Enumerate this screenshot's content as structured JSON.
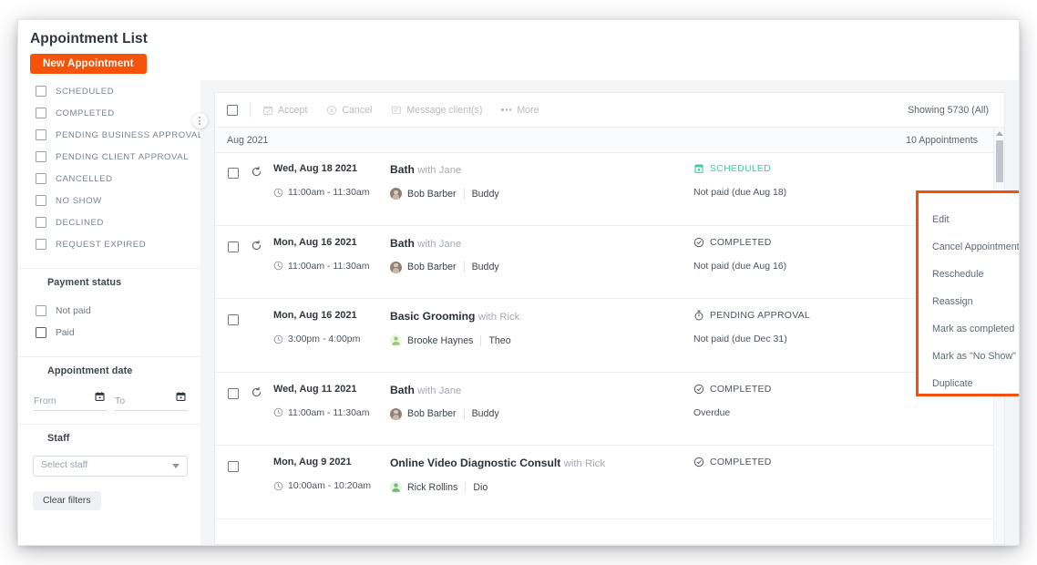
{
  "header": {
    "title": "Appointment List",
    "new_button": "New Appointment"
  },
  "sidebar": {
    "status_filters": [
      {
        "label": "SCHEDULED",
        "checked": false
      },
      {
        "label": "COMPLETED",
        "checked": false
      },
      {
        "label": "PENDING BUSINESS APPROVAL",
        "checked": false
      },
      {
        "label": "PENDING CLIENT APPROVAL",
        "checked": false
      },
      {
        "label": "CANCELLED",
        "checked": false
      },
      {
        "label": "NO SHOW",
        "checked": false
      },
      {
        "label": "DECLINED",
        "checked": false
      },
      {
        "label": "REQUEST EXPIRED",
        "checked": false
      }
    ],
    "payment": {
      "heading": "Payment status",
      "options": [
        {
          "label": "Not paid",
          "checked": false
        },
        {
          "label": "Paid",
          "checked": false
        }
      ]
    },
    "appointment_date": {
      "heading": "Appointment date",
      "from_placeholder": "From",
      "to_placeholder": "To",
      "from_value": "",
      "to_value": ""
    },
    "staff": {
      "heading": "Staff",
      "select_placeholder": "Select staff",
      "select_value": ""
    },
    "clear_filters": "Clear filters",
    "collapse_handle_icon": "drag-dots-icon"
  },
  "toolbar": {
    "select_all_checked": false,
    "actions": [
      {
        "label": "Accept",
        "icon": "calendar-check-icon",
        "enabled": false
      },
      {
        "label": "Cancel",
        "icon": "cancel-circle-icon",
        "enabled": false
      },
      {
        "label": "Message client(s)",
        "icon": "message-icon",
        "enabled": false
      },
      {
        "label": "More",
        "icon": "ellipsis-icon",
        "enabled": false
      }
    ],
    "showing": "Showing 5730 (All)"
  },
  "month_band": {
    "month": "Aug 2021",
    "count": "10 Appointments"
  },
  "appointments": [
    {
      "checked": false,
      "recurring": true,
      "date": "Wed, Aug 18 2021",
      "time": "11:00am - 11:30am",
      "service": "Bath",
      "with": "with Jane",
      "client": "Bob Barber",
      "avatar_kind": "photo",
      "pet": "Buddy",
      "status": "SCHEDULED",
      "status_icon": "calendar-icon",
      "status_color": "#3ecf9b",
      "payment": "Not paid (due Aug 18)"
    },
    {
      "checked": false,
      "recurring": true,
      "date": "Mon, Aug 16 2021",
      "time": "11:00am - 11:30am",
      "service": "Bath",
      "with": "with Jane",
      "client": "Bob Barber",
      "avatar_kind": "photo",
      "pet": "Buddy",
      "status": "COMPLETED",
      "status_icon": "check-circle-icon",
      "status_color": "#4d5561",
      "payment": "Not paid (due Aug 16)"
    },
    {
      "checked": false,
      "recurring": false,
      "date": "Mon, Aug 16 2021",
      "time": "3:00pm - 4:00pm",
      "service": "Basic Grooming",
      "with": "with Rick",
      "client": "Brooke Haynes",
      "avatar_kind": "green-light",
      "pet": "Theo",
      "status": "PENDING APPROVAL",
      "status_icon": "stopwatch-icon",
      "status_color": "#4d5561",
      "payment": "Not paid (due Dec 31)"
    },
    {
      "checked": false,
      "recurring": true,
      "date": "Wed, Aug 11 2021",
      "time": "11:00am - 11:30am",
      "service": "Bath",
      "with": "with Jane",
      "client": "Bob Barber",
      "avatar_kind": "photo",
      "pet": "Buddy",
      "status": "COMPLETED",
      "status_icon": "check-circle-icon",
      "status_color": "#4d5561",
      "payment": "Overdue"
    },
    {
      "checked": false,
      "recurring": false,
      "date": "Mon, Aug 9 2021",
      "time": "10:00am - 10:20am",
      "service": "Online Video Diagnostic Consult",
      "with": "with Rick",
      "client": "Rick Rollins",
      "avatar_kind": "green-mid",
      "pet": "Dio",
      "status": "COMPLETED",
      "status_icon": "check-circle-icon",
      "status_color": "#4d5561",
      "payment": ""
    }
  ],
  "context_menu": {
    "items": [
      "Edit",
      "Cancel Appointment",
      "Reschedule",
      "Reassign",
      "Mark as completed",
      "Mark as \"No Show\"",
      "Duplicate"
    ],
    "highlight_color": "#f4500a"
  },
  "scrollbar": {
    "up_arrow_icon": "caret-up-icon"
  },
  "colors": {
    "accent_orange": "#f6530a",
    "scheduled_green": "#3ecf9b",
    "text_dark": "#31363f",
    "text_muted": "#7c848f"
  }
}
